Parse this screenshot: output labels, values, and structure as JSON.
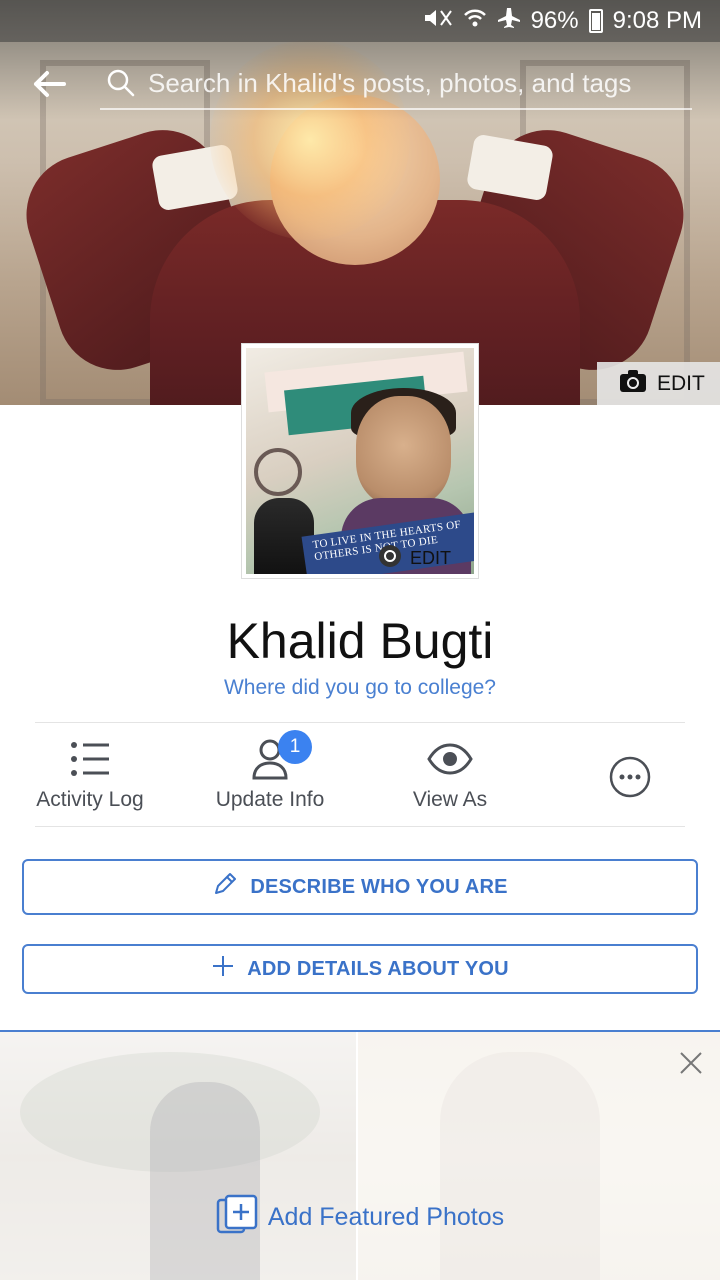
{
  "status_bar": {
    "battery": "96%",
    "time": "9:08 PM"
  },
  "search": {
    "placeholder": "Search in Khalid's posts, photos, and tags"
  },
  "cover": {
    "edit_label": "EDIT"
  },
  "profile_picture": {
    "edit_label": "EDIT",
    "quote_text": "TO LIVE IN THE HEARTS OF OTHERS IS NOT TO DIE"
  },
  "profile": {
    "name": "Khalid Bugti",
    "prompt": "Where did you go to college?"
  },
  "actions": [
    {
      "label": "Activity Log",
      "icon": "list-icon"
    },
    {
      "label": "Update Info",
      "icon": "person-icon",
      "badge": "1"
    },
    {
      "label": "View As",
      "icon": "eye-icon"
    },
    {
      "label": "",
      "icon": "more-icon"
    }
  ],
  "buttons": {
    "describe": "DESCRIBE WHO YOU ARE",
    "add_details": "ADD DETAILS ABOUT YOU"
  },
  "featured": {
    "label": "Add Featured Photos"
  },
  "colors": {
    "accent": "#3a72c8",
    "badge": "#3b82f0"
  }
}
